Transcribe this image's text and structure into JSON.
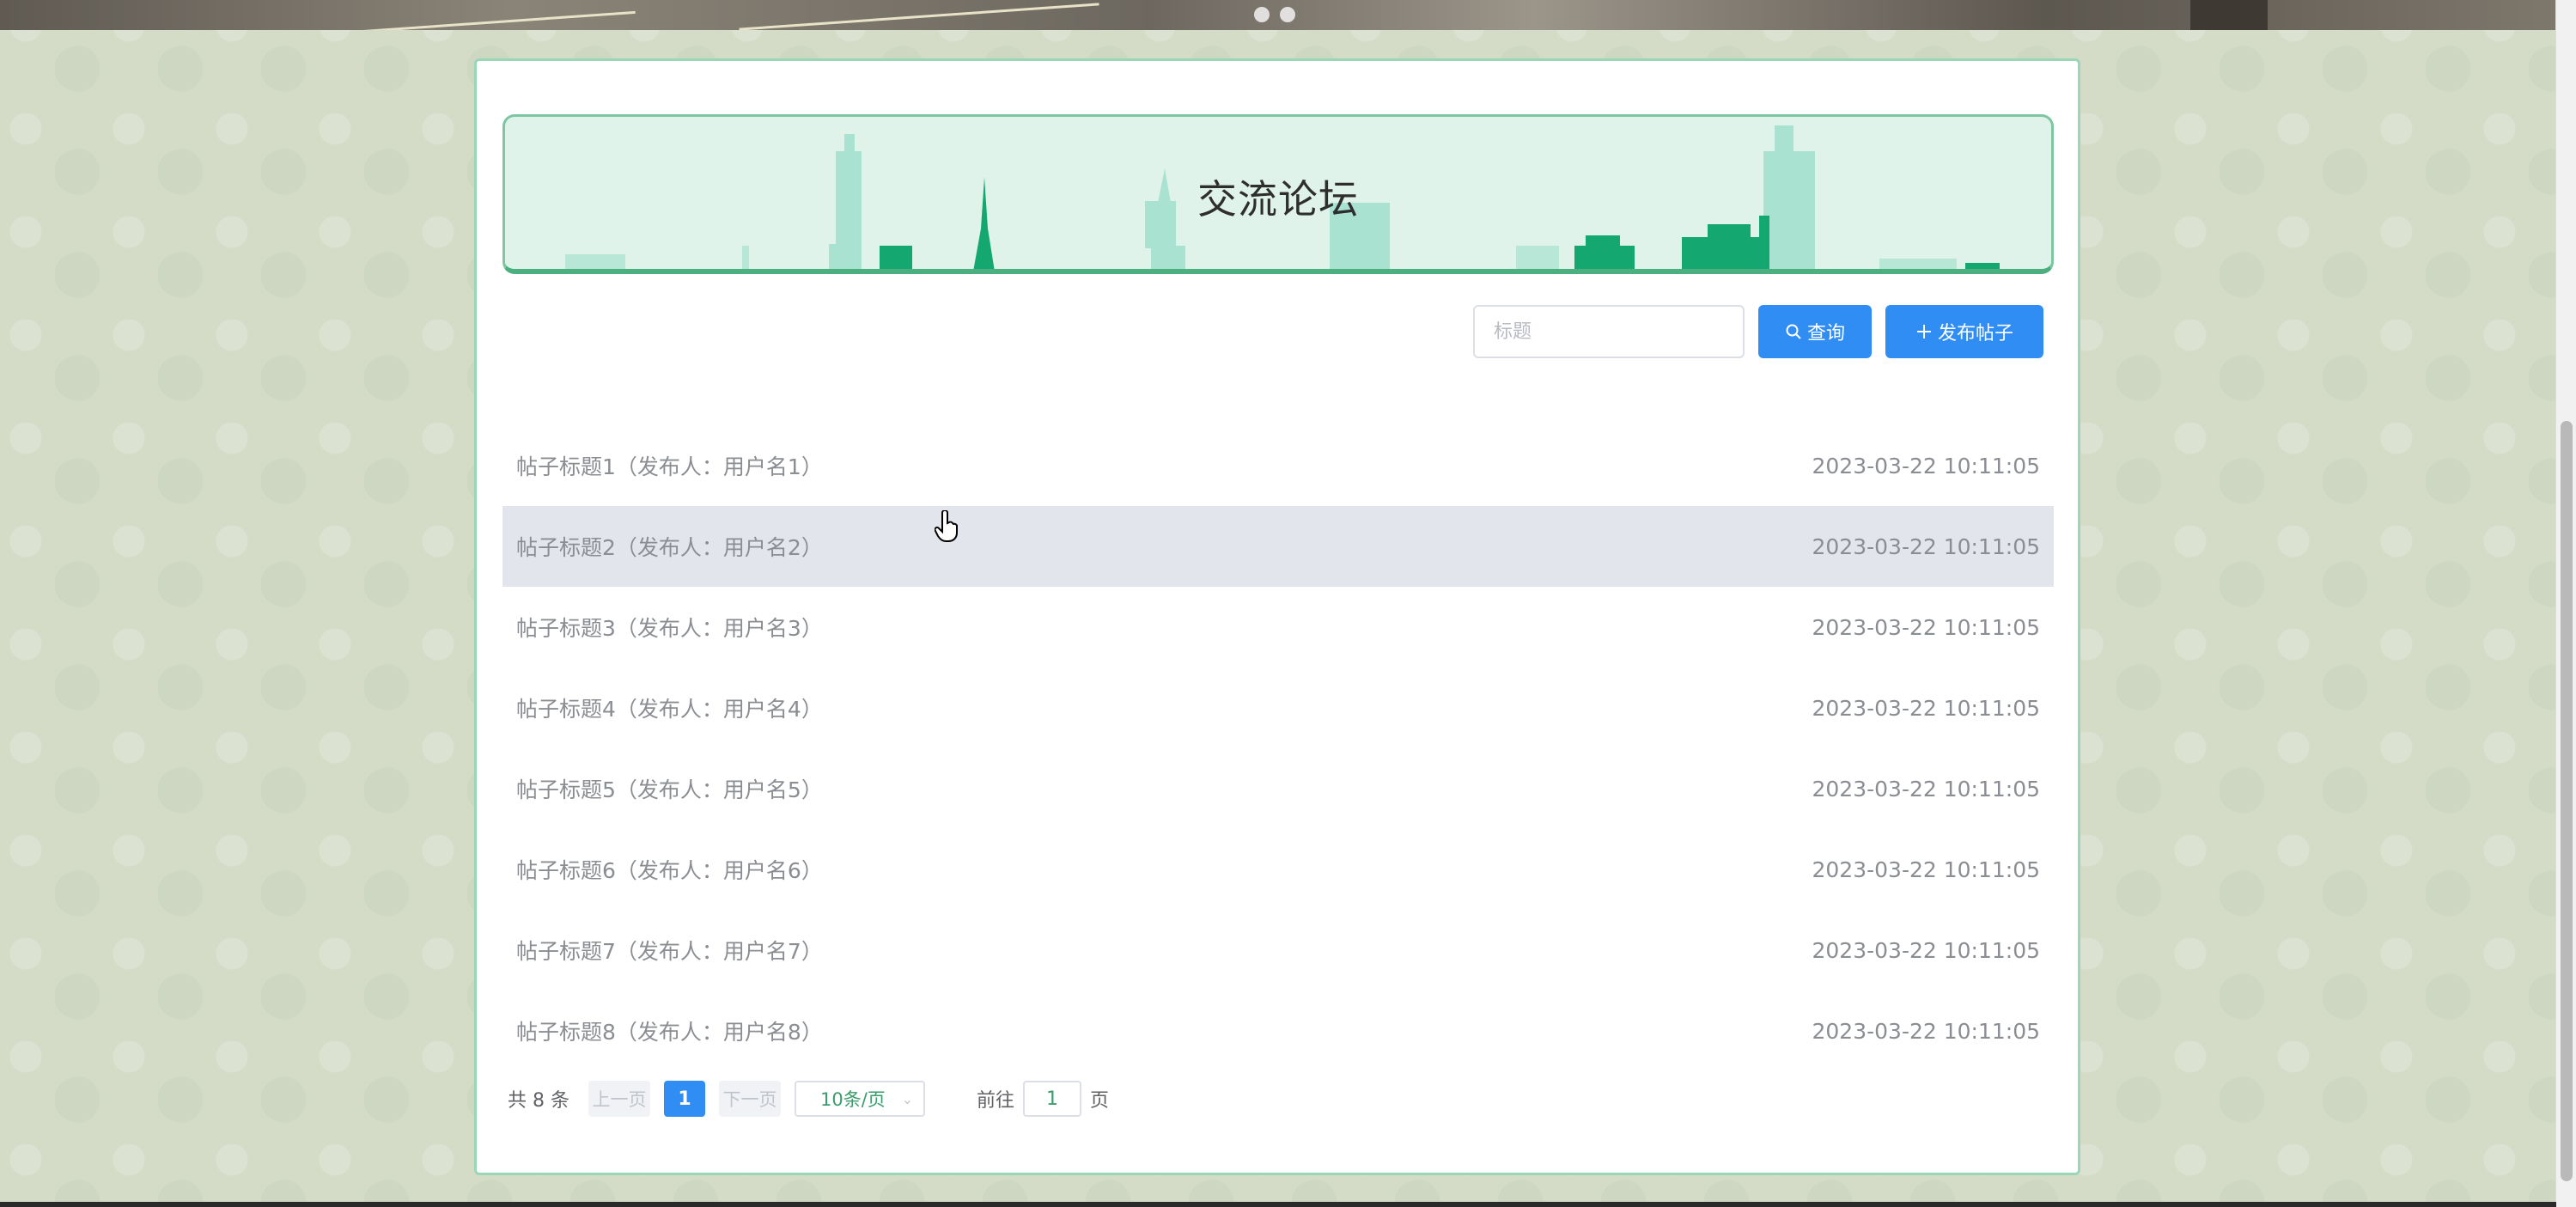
{
  "forum": {
    "title": "交流论坛",
    "search_placeholder": "标题",
    "search_button": "查询",
    "search_icon": "search-icon",
    "post_button": "发布帖子",
    "post_icon": "plus-icon"
  },
  "posts": [
    {
      "label": "帖子标题1（发布人：用户名1）",
      "time": "2023-03-22 10:11:05"
    },
    {
      "label": "帖子标题2（发布人：用户名2）",
      "time": "2023-03-22 10:11:05"
    },
    {
      "label": "帖子标题3（发布人：用户名3）",
      "time": "2023-03-22 10:11:05"
    },
    {
      "label": "帖子标题4（发布人：用户名4）",
      "time": "2023-03-22 10:11:05"
    },
    {
      "label": "帖子标题5（发布人：用户名5）",
      "time": "2023-03-22 10:11:05"
    },
    {
      "label": "帖子标题6（发布人：用户名6）",
      "time": "2023-03-22 10:11:05"
    },
    {
      "label": "帖子标题7（发布人：用户名7）",
      "time": "2023-03-22 10:11:05"
    },
    {
      "label": "帖子标题8（发布人：用户名8）",
      "time": "2023-03-22 10:11:05"
    }
  ],
  "pagination": {
    "total": "共 8 条",
    "prev": "上一页",
    "current_page": "1",
    "next": "下一页",
    "page_size": "10条/页",
    "goto_label": "前往",
    "goto_value": "1",
    "page_unit": "页"
  },
  "colors": {
    "accent": "#2f8df4",
    "card_border": "#9ad7b7",
    "banner_bg": "#dff3ea",
    "skyline_dark": "#14a870",
    "skyline_light": "#a9e2d1"
  }
}
